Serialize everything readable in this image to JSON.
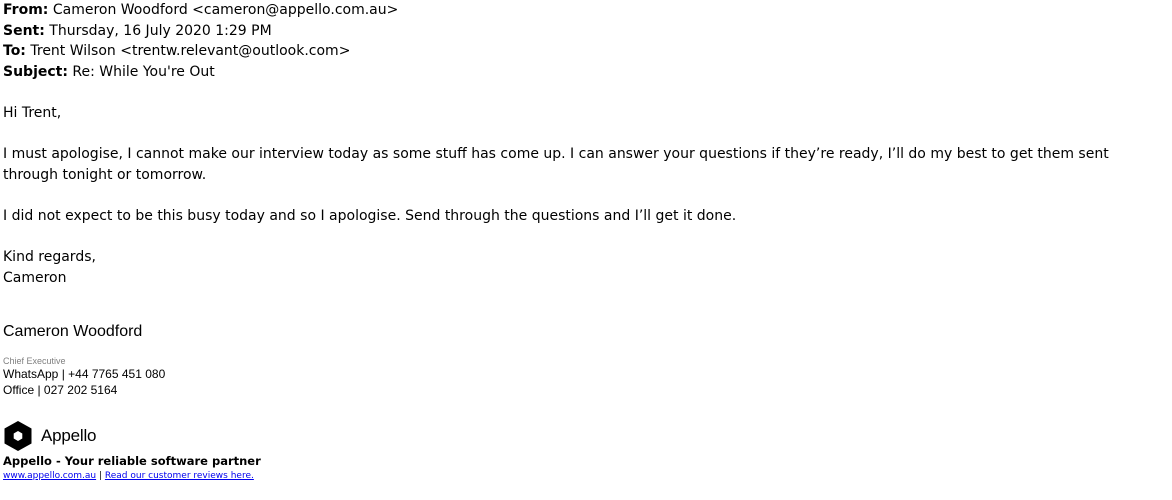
{
  "header": {
    "from_label": "From:",
    "from_value": "Cameron Woodford <cameron@appello.com.au>",
    "sent_label": "Sent:",
    "sent_value": "Thursday, 16 July 2020 1:29 PM",
    "to_label": "To:",
    "to_value": "Trent Wilson <trentw.relevant@outlook.com>",
    "subject_label": "Subject:",
    "subject_value": "Re: While You're Out"
  },
  "body": {
    "greeting": "Hi Trent,",
    "paragraph1": "I must apologise, I cannot make our interview today as some stuff has come up. I can answer your questions if they’re ready, I’ll do my best to get them sent through tonight or tomorrow.",
    "paragraph2": "I did not expect to be this busy today and so I apologise. Send through the questions and I’ll get it done.",
    "closing": "Kind regards,",
    "sender_first_name": "Cameron"
  },
  "signature": {
    "name": "Cameron Woodford",
    "role": "Chief Executive",
    "whatsapp": "WhatsApp | +44 7765 451 080",
    "office": "Office | 027 202 5164",
    "brand_name": "Appello",
    "brand_icon": "hexagon-logo-icon",
    "tagline": "Appello - Your reliable software partner",
    "website_link": "www.appello.com.au",
    "separator": "|",
    "reviews_link": "Read our customer reviews here.",
    "link_color": "#0000ee",
    "role_color": "#808080"
  }
}
